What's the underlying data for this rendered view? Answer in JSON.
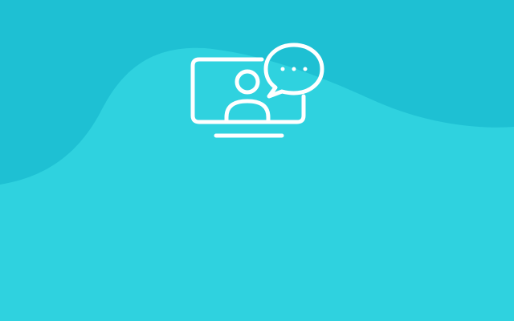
{
  "colors": {
    "background_light": "#2fd2df",
    "background_dark": "#1ec0d3",
    "icon_stroke": "#ffffff"
  },
  "icon": {
    "name": "video-chat-icon"
  }
}
